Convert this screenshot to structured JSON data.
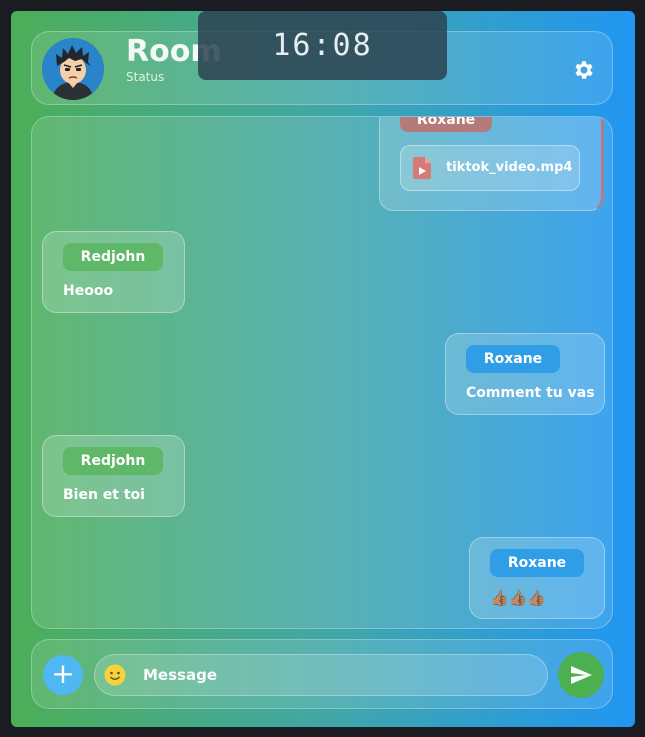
{
  "header": {
    "room_title": "Room",
    "status": "Status",
    "clock": "16:08"
  },
  "icons": {
    "avatar": "avatar-boy",
    "settings": "gear-icon",
    "file": "video-file-icon",
    "add": "plus-icon",
    "emoji": "smiley-icon",
    "send": "send-icon"
  },
  "colors": {
    "gradient_start": "#4cae57",
    "gradient_end": "#2196f2",
    "pill_roxane": "#2f9ee6",
    "pill_roxane_top": "#b57a7a",
    "pill_redjohn": "#5fb867",
    "send_button": "#4caf50",
    "add_button": "#4fb7f1"
  },
  "messages": [
    {
      "sender": "Roxane",
      "type": "file",
      "filename": "tiktok_video.mp4",
      "side": "right"
    },
    {
      "sender": "Redjohn",
      "type": "text",
      "text": "Heooo",
      "side": "left"
    },
    {
      "sender": "Roxane",
      "type": "text",
      "text": "Comment tu vas",
      "side": "right"
    },
    {
      "sender": "Redjohn",
      "type": "text",
      "text": "Bien et toi",
      "side": "left"
    },
    {
      "sender": "Roxane",
      "type": "text",
      "text": "👍🏽👍🏽👍🏽",
      "side": "right"
    }
  ],
  "composer": {
    "placeholder": "Message",
    "add_symbol": "+"
  }
}
